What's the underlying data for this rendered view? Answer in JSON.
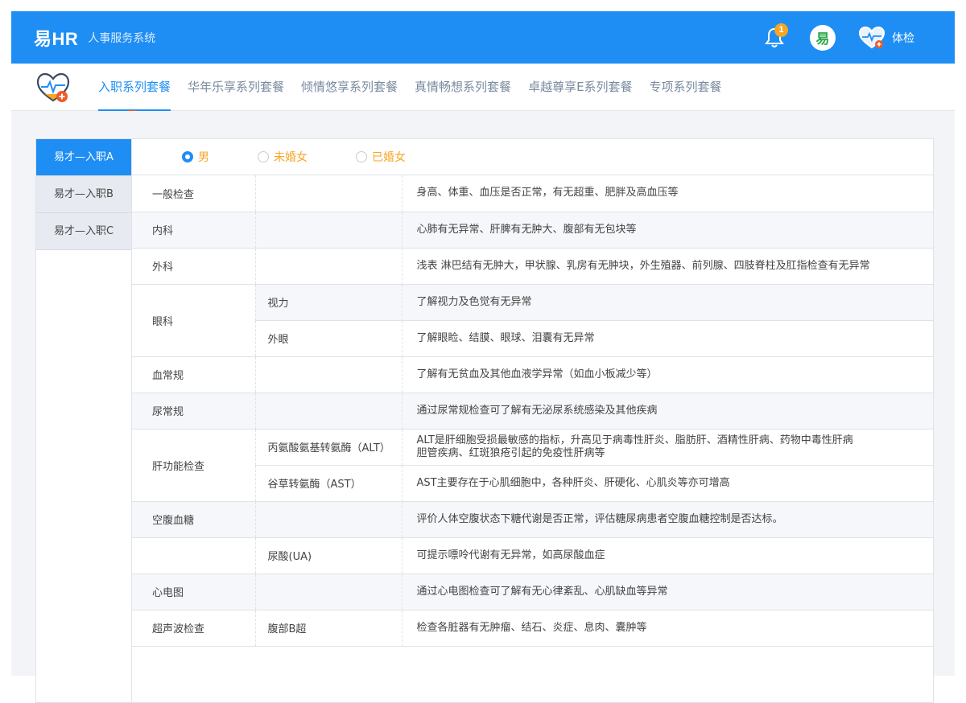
{
  "header": {
    "brand": "易HR",
    "subtitle": "人事服务系统",
    "notification_count": "1",
    "user_label": "体检",
    "logo_glyph": "易",
    "accent_color": "#1e8ef5"
  },
  "tabs": [
    {
      "label": "入职系列套餐"
    },
    {
      "label": "华年乐享系列套餐"
    },
    {
      "label": "倾情悠享系列套餐"
    },
    {
      "label": "真情畅想系列套餐"
    },
    {
      "label": "卓越尊享E系列套餐"
    },
    {
      "label": "专项系列套餐"
    }
  ],
  "sidebar": {
    "items": [
      {
        "label": "易才—入职A"
      },
      {
        "label": "易才—入职B"
      },
      {
        "label": "易才—入职C"
      }
    ]
  },
  "gender_options": [
    {
      "label": "男"
    },
    {
      "label": "未婚女"
    },
    {
      "label": "已婚女"
    }
  ],
  "exam": {
    "rows": [
      {
        "category": "一般检查",
        "item": "",
        "desc": "身高、体重、血压是否正常，有无超重、肥胖及高血压等"
      },
      {
        "category": "内科",
        "item": "",
        "desc": "心肺有无异常、肝脾有无肿大、腹部有无包块等"
      },
      {
        "category": "外科",
        "item": "",
        "desc": "浅表  淋巴结有无肿大，甲状腺、乳房有无肿块，外生殖器、前列腺、四肢脊柱及肛指检查有无异常"
      },
      {
        "category": "眼科",
        "item": "视力",
        "desc": "了解视力及色觉有无异常"
      },
      {
        "item": "外眼",
        "desc": "了解眼睑、结膜、眼球、泪囊有无异常"
      },
      {
        "category": "血常规",
        "item": "",
        "desc": "了解有无贫血及其他血液学异常（如血小板减少等）"
      },
      {
        "category": "尿常规",
        "item": "",
        "desc": "通过尿常规检查可了解有无泌尿系统感染及其他疾病"
      },
      {
        "category": "肝功能检查",
        "item": "丙氨酸氨基转氨酶（ALT）",
        "desc": "ALT是肝细胞受损最敏感的指标，升高见于病毒性肝炎、脂肪肝、酒精性肝病、药物中毒性肝病",
        "desc2": "胆管疾病、红斑狼疮引起的免疫性肝病等"
      },
      {
        "item": "谷草转氨酶（AST）",
        "desc": "AST主要存在于心肌细胞中，各种肝炎、肝硬化、心肌炎等亦可增高"
      },
      {
        "category": "空腹血糖",
        "item": "",
        "desc": "评价人体空腹状态下糖代谢是否正常，评估糖尿病患者空腹血糖控制是否达标。"
      },
      {
        "category": "",
        "item": "尿酸(UA)",
        "desc": "可提示嘌呤代谢有无异常，如高尿酸血症"
      },
      {
        "category": "心电图",
        "item": "",
        "desc": "通过心电图检查可了解有无心律紊乱、心肌缺血等异常"
      },
      {
        "category": "超声波检查",
        "item": "腹部B超",
        "desc": "检查各脏器有无肿瘤、结石、炎症、息肉、囊肿等"
      }
    ]
  }
}
